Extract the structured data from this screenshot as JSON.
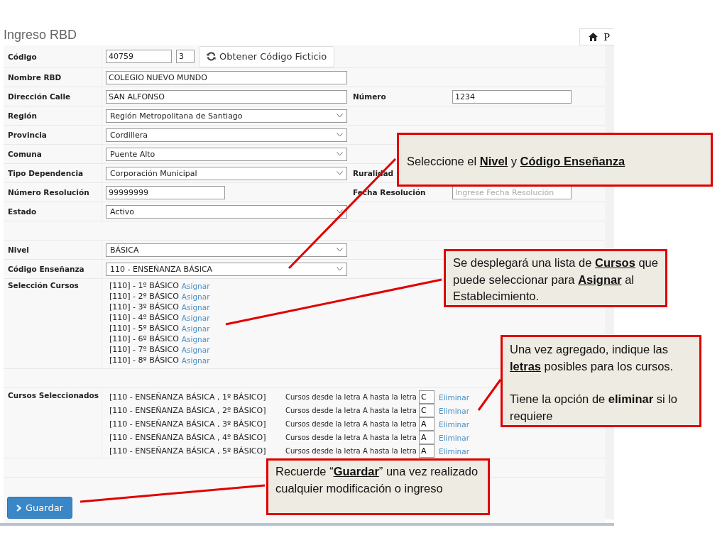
{
  "title": "Ingreso RBD",
  "home_button": {
    "label": "P"
  },
  "rows": [
    {
      "kind": "code",
      "label": "Código",
      "value": "40759",
      "check_digit": "3",
      "button": "Obtener Código Ficticio"
    },
    {
      "kind": "text",
      "label": "Nombre RBD",
      "value": "COLEGIO NUEVO MUNDO"
    },
    {
      "kind": "text",
      "label": "Dirección Calle",
      "value": "SAN ALFONSO",
      "side": {
        "label": "Número",
        "value": "1234"
      }
    },
    {
      "kind": "select",
      "label": "Región",
      "value": "Región Metropolitana de Santiago"
    },
    {
      "kind": "select",
      "label": "Provincia",
      "value": "Cordillera"
    },
    {
      "kind": "select",
      "label": "Comuna",
      "value": "Puente Alto"
    },
    {
      "kind": "select",
      "label": "Tipo Dependencia",
      "value": "Corporación Municipal",
      "side": {
        "label": "Ruralidad"
      }
    },
    {
      "kind": "short",
      "label": "Número Resolución",
      "value": "99999999",
      "side": {
        "label": "Fecha Resolución",
        "placeholder": "Ingrese Fecha Resolución"
      }
    },
    {
      "kind": "select",
      "label": "Estado",
      "value": "Activo"
    },
    {
      "kind": "spacer"
    },
    {
      "kind": "select",
      "label": "Nivel",
      "value": "BÁSICA"
    },
    {
      "kind": "select",
      "label": "Código Enseñanza",
      "value": "110 - ENSEÑANZA BÁSICA"
    },
    {
      "kind": "courses",
      "label": "Selección Cursos",
      "items": [
        {
          "text": "[110] - 1º BÁSICO",
          "action": "Asignar"
        },
        {
          "text": "[110] - 2º BÁSICO",
          "action": "Asignar"
        },
        {
          "text": "[110] - 3º BÁSICO",
          "action": "Asignar"
        },
        {
          "text": "[110] - 4º BÁSICO",
          "action": "Asignar"
        },
        {
          "text": "[110] - 5º BÁSICO",
          "action": "Asignar"
        },
        {
          "text": "[110] - 6º BÁSICO",
          "action": "Asignar"
        },
        {
          "text": "[110] - 7º BÁSICO",
          "action": "Asignar"
        },
        {
          "text": "[110] - 8º BÁSICO",
          "action": "Asignar"
        }
      ]
    },
    {
      "kind": "spacer"
    },
    {
      "kind": "selected",
      "label": "Cursos Seleccionados",
      "items": [
        {
          "course": "[110 - ENSEÑANZA BÁSICA , 1º BÁSICO]",
          "range": "Cursos desde la letra A hasta la letra",
          "letter": "C",
          "action": "Eliminar"
        },
        {
          "course": "[110 - ENSEÑANZA BÁSICA , 2º BÁSICO]",
          "range": "Cursos desde la letra A hasta la letra",
          "letter": "C",
          "action": "Eliminar"
        },
        {
          "course": "[110 - ENSEÑANZA BÁSICA , 3º BÁSICO]",
          "range": "Cursos desde la letra A hasta la letra",
          "letter": "A",
          "action": "Eliminar"
        },
        {
          "course": "[110 - ENSEÑANZA BÁSICA , 4º BÁSICO]",
          "range": "Cursos desde la letra A hasta la letra",
          "letter": "A",
          "action": "Eliminar"
        },
        {
          "course": "[110 - ENSEÑANZA BÁSICA , 5º BÁSICO]",
          "range": "Cursos desde la letra A hasta la letra",
          "letter": "A",
          "action": "Eliminar"
        }
      ]
    },
    {
      "kind": "spacer"
    }
  ],
  "save_button": {
    "label": "Guardar"
  },
  "callouts": [
    {
      "paragraphs": [
        [
          {
            "text": "Seleccione el ",
            "kind": "plain"
          },
          {
            "text": "Nivel",
            "kind": "term"
          },
          {
            "text": " y ",
            "kind": "plain"
          },
          {
            "text": "Código Enseñanza",
            "kind": "term"
          }
        ]
      ]
    },
    {
      "paragraphs": [
        [
          {
            "text": "Se desplegará una lista de ",
            "kind": "plain"
          },
          {
            "text": "Cursos",
            "kind": "term"
          },
          {
            "text": " que puede seleccionar para ",
            "kind": "plain"
          },
          {
            "text": "Asignar",
            "kind": "term"
          },
          {
            "text": " al Establecimiento.",
            "kind": "plain"
          }
        ]
      ]
    },
    {
      "paragraphs": [
        [
          {
            "text": "Una vez agregado, indique las ",
            "kind": "plain"
          },
          {
            "text": "letras",
            "kind": "term"
          },
          {
            "text": " posibles para los cursos.",
            "kind": "plain"
          }
        ],
        [
          {
            "text": "Tiene la opción de ",
            "kind": "plain"
          },
          {
            "text": "eliminar",
            "kind": "strong"
          },
          {
            "text": " si lo requiere",
            "kind": "plain"
          }
        ]
      ]
    },
    {
      "paragraphs": [
        [
          {
            "text": "Recuerde “",
            "kind": "plain"
          },
          {
            "text": "Guardar",
            "kind": "term"
          },
          {
            "text": "” una vez realizado cualquier modificación o ingreso",
            "kind": "plain"
          }
        ]
      ]
    }
  ]
}
